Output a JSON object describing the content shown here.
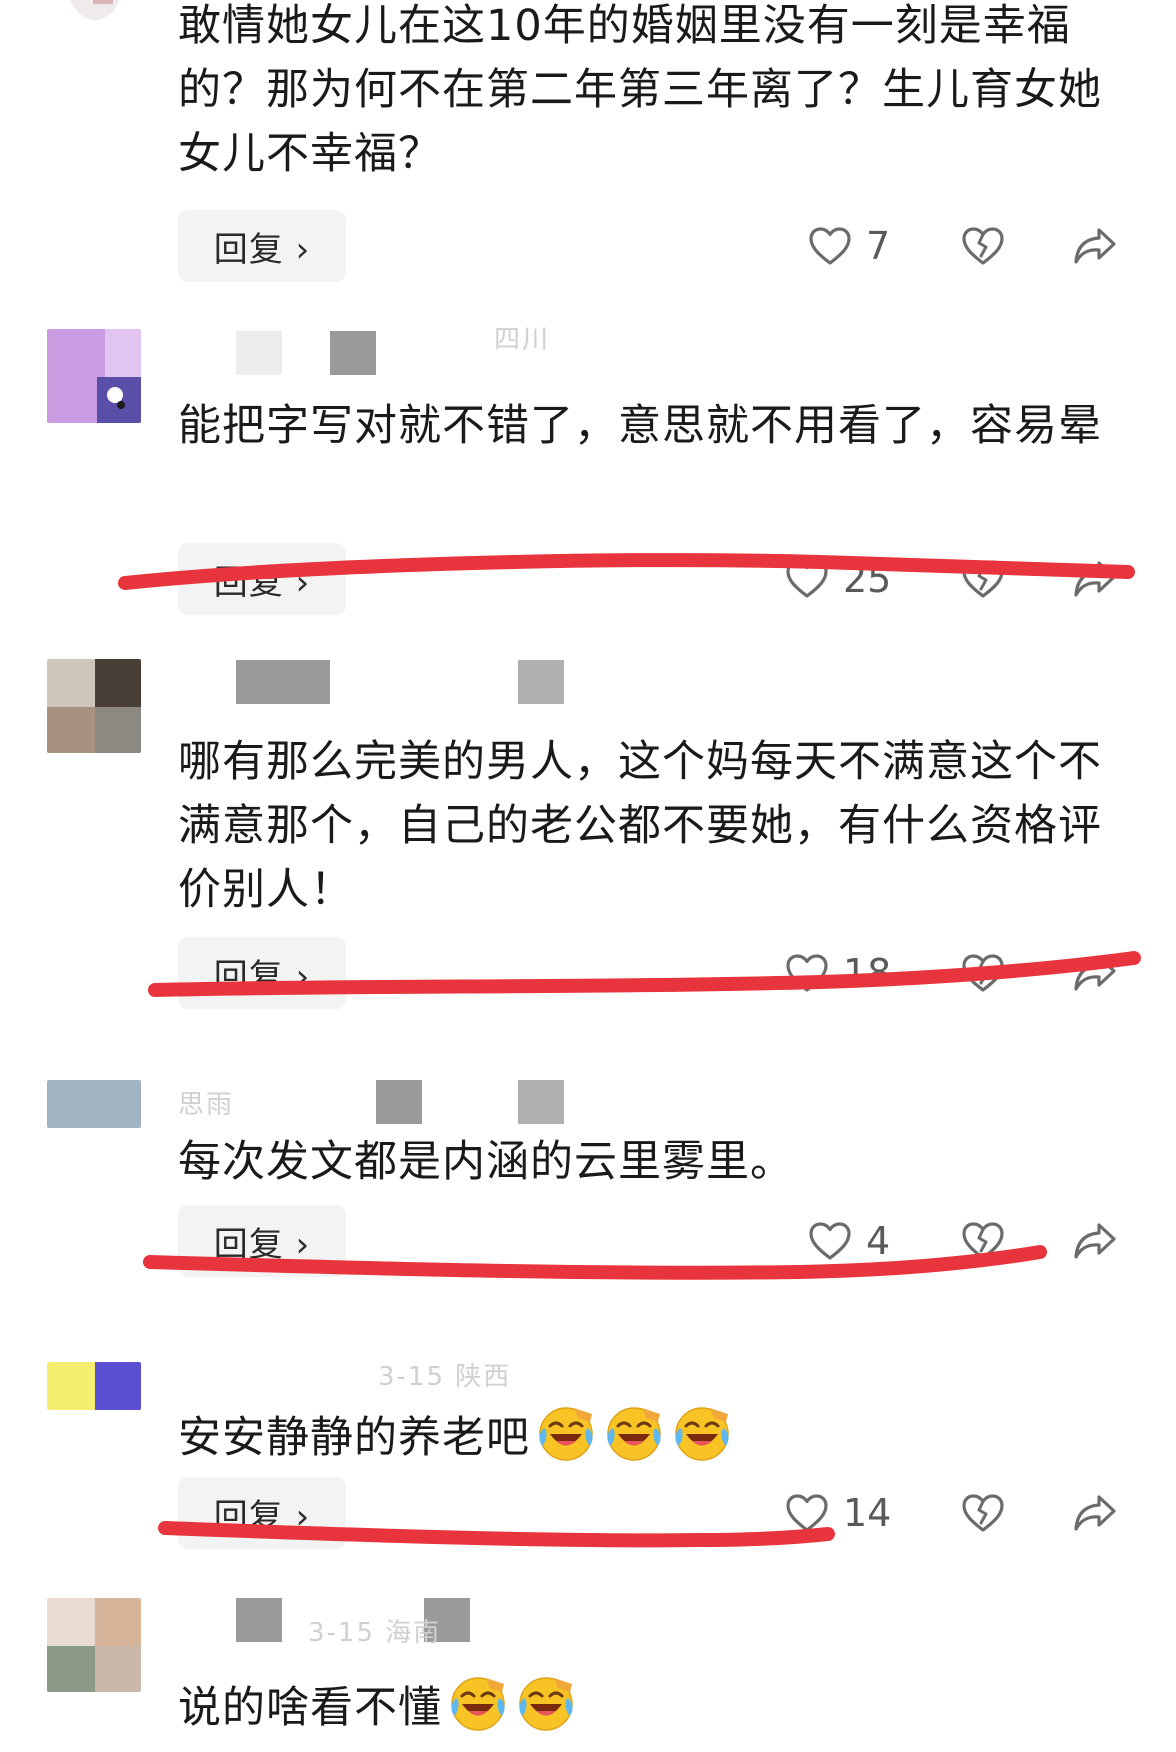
{
  "reply_label": "回复 ›",
  "comments": [
    {
      "text": "敢情她女儿在这10年的婚姻里没有一刻是幸福的？那为何不在第二年第三年离了？生儿育女她女儿不幸福？",
      "likes": "7",
      "meta_ghost": "",
      "struck_through": false
    },
    {
      "text": "能把字写对就不错了，意思就不用看了，容易晕",
      "likes": "25",
      "meta_ghost": "四川",
      "struck_through": true
    },
    {
      "text": "哪有那么完美的男人，这个妈每天不满意这个不满意那个，自己的老公都不要她，有什么资格评价别人！",
      "likes": "18",
      "meta_ghost": "",
      "struck_through": true
    },
    {
      "text": "每次发文都是内涵的云里雾里。",
      "likes": "4",
      "meta_ghost": "思雨",
      "struck_through": true
    },
    {
      "text": "安安静静的养老吧",
      "likes": "14",
      "meta_ghost": "3-15 陕西",
      "emoji_count": 3,
      "emoji_name": "laughing-crying-emoji",
      "struck_through": true
    },
    {
      "text": "说的啥看不懂",
      "likes": "",
      "meta_ghost": "3-15 海南",
      "emoji_count": 2,
      "emoji_name": "laughing-crying-emoji",
      "struck_through": false
    }
  ],
  "colors": {
    "strike_red": "#e8343c",
    "icon_gray": "#6b6b6b",
    "reply_bg": "#f3f3f3"
  },
  "icons": {
    "like": "heart-icon",
    "dislike": "broken-heart-icon",
    "share": "share-arrow-icon"
  }
}
